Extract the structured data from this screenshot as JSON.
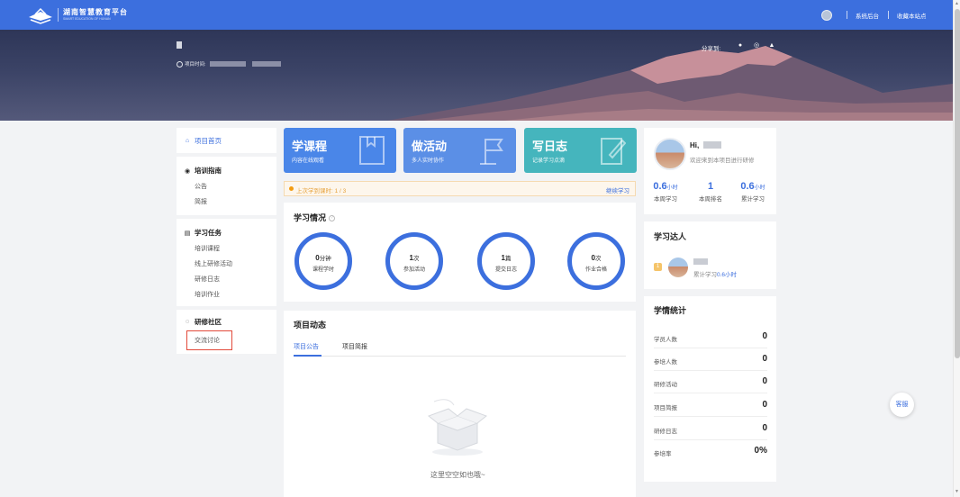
{
  "header": {
    "brand_cn": "湖南智慧教育平台",
    "brand_en": "SMART EDUCATION OF HUNAN",
    "links": [
      "系统后台",
      "收藏本站点"
    ]
  },
  "banner": {
    "time_label": "项目时间:",
    "share_label": "分享到:"
  },
  "leftnav": {
    "home": "项目首页",
    "guide_title": "培训指南",
    "guide_items": [
      "公告",
      "简报"
    ],
    "task_title": "学习任务",
    "task_items": [
      "培训课程",
      "线上研修活动",
      "研修日志",
      "培训作业"
    ],
    "community_title": "研修社区",
    "community_items": [
      "交流讨论"
    ]
  },
  "cards": [
    {
      "title": "学课程",
      "sub": "内容在线观看",
      "color": "#4a86e8"
    },
    {
      "title": "做活动",
      "sub": "多人实时协作",
      "color": "#5b8fe6"
    },
    {
      "title": "写日志",
      "sub": "记录学习点滴",
      "color": "#45b5bd"
    }
  ],
  "notice": {
    "text": "上次学到课时: 1 / 3",
    "link": "继续学习"
  },
  "study": {
    "title": "学习情况",
    "rings": [
      {
        "value": "0",
        "unit": "分钟",
        "label": "课程学时"
      },
      {
        "value": "1",
        "unit": "次",
        "label": "参加活动"
      },
      {
        "value": "1",
        "unit": "篇",
        "label": "提交日志"
      },
      {
        "value": "0",
        "unit": "次",
        "label": "作业合格"
      }
    ]
  },
  "news": {
    "title": "项目动态",
    "tabs": [
      "项目公告",
      "项目简报"
    ],
    "empty_text": "这里空空如也哦~"
  },
  "profile": {
    "hi": "Hi,",
    "welcome": "欢迎来到本项目进行研修",
    "stats": [
      {
        "value": "0.6",
        "unit": "小时",
        "label": "本周学习"
      },
      {
        "value": "1",
        "unit": "",
        "label": "本周排名"
      },
      {
        "value": "0.6",
        "unit": "小时",
        "label": "累计学习"
      }
    ]
  },
  "ranking": {
    "title": "学习达人",
    "badge": "1",
    "sub_prefix": "累计学习",
    "sub_value": "0.6小时"
  },
  "statistics": {
    "title": "学情统计",
    "rows": [
      {
        "label": "学员人数",
        "value": "0"
      },
      {
        "label": "参培人数",
        "value": "0"
      },
      {
        "label": "研修活动",
        "value": "0"
      },
      {
        "label": "项目简报",
        "value": "0"
      },
      {
        "label": "研修日志",
        "value": "0"
      },
      {
        "label": "参培率",
        "value": "0%"
      }
    ]
  },
  "float_button": "客服"
}
